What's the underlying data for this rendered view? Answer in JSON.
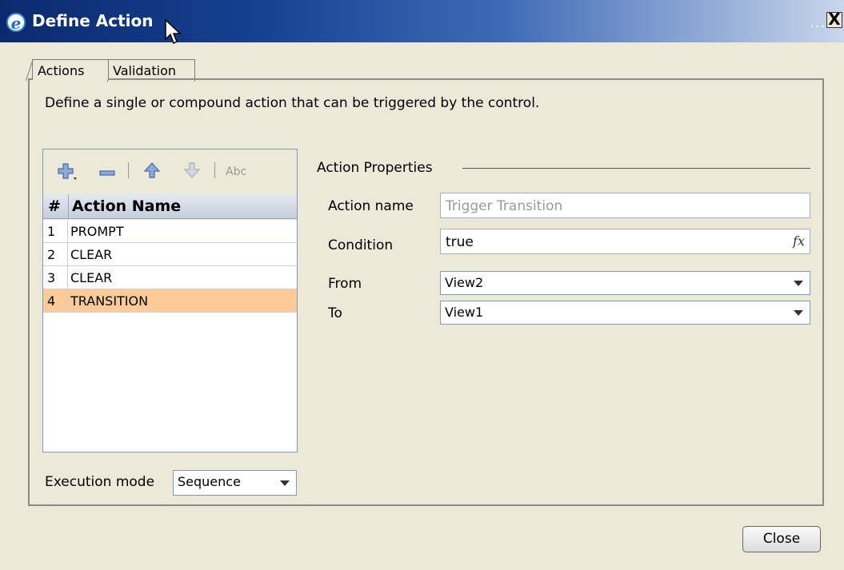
{
  "window": {
    "title": "Define Action",
    "icon": "ie-icon",
    "dots": "...",
    "close": "X"
  },
  "tabs": [
    {
      "label": "Actions",
      "active": true
    },
    {
      "label": "Validation",
      "active": false
    }
  ],
  "description": "Define a single or compound action that can be triggered by the control.",
  "toolbar": {
    "add_icon": "add-plus-icon",
    "remove_icon": "remove-minus-icon",
    "up_icon": "arrow-up-icon",
    "down_icon": "arrow-down-icon",
    "rename_icon": "rename-abc-icon",
    "rename_label": "Abc"
  },
  "actions_table": {
    "columns": [
      "#",
      "Action Name"
    ],
    "rows": [
      {
        "num": "1",
        "name": "PROMPT"
      },
      {
        "num": "2",
        "name": "CLEAR"
      },
      {
        "num": "3",
        "name": "CLEAR"
      },
      {
        "num": "4",
        "name": "TRANSITION",
        "selected": true
      }
    ]
  },
  "execution_mode": {
    "label": "Execution mode",
    "value": "Sequence"
  },
  "properties": {
    "group_label": "Action Properties",
    "action_name": {
      "label": "Action name",
      "value": "Trigger Transition"
    },
    "condition": {
      "label": "Condition",
      "value": "true",
      "fx": "fx"
    },
    "from": {
      "label": "From",
      "value": "View2"
    },
    "to": {
      "label": "To",
      "value": "View1"
    }
  },
  "buttons": {
    "close": "Close"
  },
  "colors": {
    "selected_row": "#fccb97",
    "titlebar_dark": "#0b2a6e",
    "background": "#ece9d8"
  }
}
